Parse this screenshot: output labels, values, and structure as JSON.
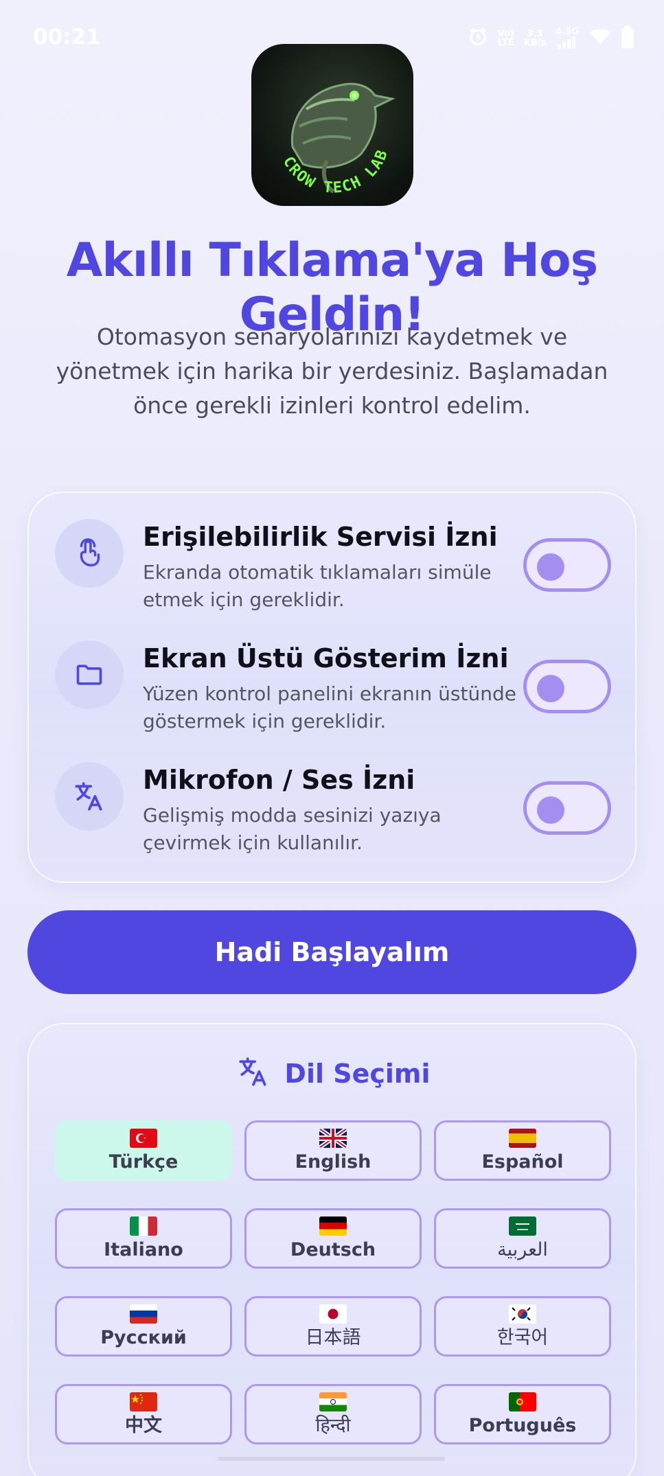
{
  "status_bar": {
    "time": "00:21",
    "network_label_1": "Vo)",
    "network_label_2": "LTE",
    "speed_value": "3,3",
    "speed_unit": "KB/s",
    "signal_label": "4.5G"
  },
  "logo": {
    "text": "CROW TECH LAB"
  },
  "header": {
    "title": "Akıllı Tıklama'ya Hoş Geldin!",
    "subtitle": "Otomasyon senaryolarınızı kaydetmek ve yönetmek için harika bir yerdesiniz. Başlamadan önce gerekli izinleri kontrol edelim."
  },
  "permissions": [
    {
      "icon": "touch-icon",
      "title": "Erişilebilirlik Servisi İzni",
      "description": "Ekranda otomatik tıklamaları simüle etmek için gereklidir.",
      "enabled": false
    },
    {
      "icon": "folder-icon",
      "title": "Ekran Üstü Gösterim İzni",
      "description": "Yüzen kontrol panelini ekranın üstünde göstermek için gereklidir.",
      "enabled": false
    },
    {
      "icon": "translate-icon",
      "title": "Mikrofon / Ses İzni",
      "description": "Gelişmiş modda sesinizi yazıya çevirmek için kullanılır.",
      "enabled": false
    }
  ],
  "start_button": {
    "label": "Hadi Başlayalım"
  },
  "language_section": {
    "title": "Dil Seçimi",
    "selected": "Türkçe",
    "languages": [
      {
        "label": "Türkçe",
        "flag": "tr"
      },
      {
        "label": "English",
        "flag": "gb"
      },
      {
        "label": "Español",
        "flag": "es"
      },
      {
        "label": "Italiano",
        "flag": "it"
      },
      {
        "label": "Deutsch",
        "flag": "de"
      },
      {
        "label": "العربية",
        "flag": "sa"
      },
      {
        "label": "Русский",
        "flag": "ru"
      },
      {
        "label": "日本語",
        "flag": "jp"
      },
      {
        "label": "한국어",
        "flag": "kr"
      },
      {
        "label": "中文",
        "flag": "cn"
      },
      {
        "label": "हिन्दी",
        "flag": "in"
      },
      {
        "label": "Português",
        "flag": "pt"
      }
    ]
  },
  "colors": {
    "accent": "#5046e0",
    "toggle": "#a48ef0",
    "selected_language_bg": "#ccf8ec"
  }
}
